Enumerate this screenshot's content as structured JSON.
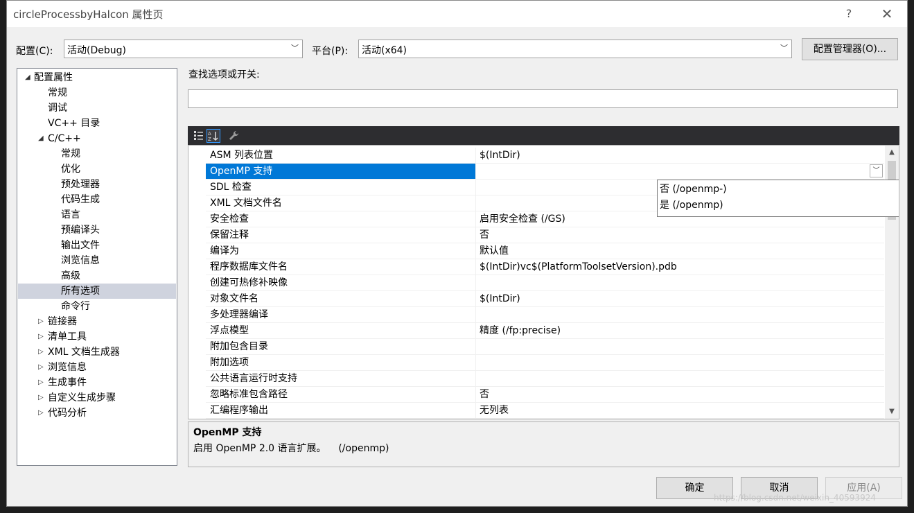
{
  "window": {
    "title": "circleProcessbyHalcon 属性页",
    "help_label": "?",
    "close_label": "✕"
  },
  "config": {
    "config_label": "配置(C):",
    "config_value": "活动(Debug)",
    "platform_label": "平台(P):",
    "platform_value": "活动(x64)",
    "manager_button": "配置管理器(O)..."
  },
  "tree": {
    "items": [
      {
        "label": "配置属性",
        "level": 0,
        "expander": "◢"
      },
      {
        "label": "常规",
        "level": 1,
        "expander": ""
      },
      {
        "label": "调试",
        "level": 1,
        "expander": ""
      },
      {
        "label": "VC++ 目录",
        "level": 1,
        "expander": ""
      },
      {
        "label": "C/C++",
        "level": 1,
        "expander": "◢"
      },
      {
        "label": "常规",
        "level": 2,
        "expander": ""
      },
      {
        "label": "优化",
        "level": 2,
        "expander": ""
      },
      {
        "label": "预处理器",
        "level": 2,
        "expander": ""
      },
      {
        "label": "代码生成",
        "level": 2,
        "expander": ""
      },
      {
        "label": "语言",
        "level": 2,
        "expander": ""
      },
      {
        "label": "预编译头",
        "level": 2,
        "expander": ""
      },
      {
        "label": "输出文件",
        "level": 2,
        "expander": ""
      },
      {
        "label": "浏览信息",
        "level": 2,
        "expander": ""
      },
      {
        "label": "高级",
        "level": 2,
        "expander": ""
      },
      {
        "label": "所有选项",
        "level": 2,
        "expander": "",
        "selected": true
      },
      {
        "label": "命令行",
        "level": 2,
        "expander": ""
      },
      {
        "label": "链接器",
        "level": 1,
        "expander": "▷"
      },
      {
        "label": "清单工具",
        "level": 1,
        "expander": "▷"
      },
      {
        "label": "XML 文档生成器",
        "level": 1,
        "expander": "▷"
      },
      {
        "label": "浏览信息",
        "level": 1,
        "expander": "▷"
      },
      {
        "label": "生成事件",
        "level": 1,
        "expander": "▷"
      },
      {
        "label": "自定义生成步骤",
        "level": 1,
        "expander": "▷"
      },
      {
        "label": "代码分析",
        "level": 1,
        "expander": "▷"
      }
    ]
  },
  "search": {
    "label": "查找选项或开关:",
    "value": ""
  },
  "toolbar": {
    "categorized_icon": "categorized-icon",
    "alphabetical_icon": "alphabetical-icon",
    "property_pages_icon": "wrench-icon"
  },
  "properties": [
    {
      "name": "ASM 列表位置",
      "value": "$(IntDir)"
    },
    {
      "name": "OpenMP 支持",
      "value": "",
      "selected": true
    },
    {
      "name": "SDL 检查",
      "value": ""
    },
    {
      "name": "XML 文档文件名",
      "value": ""
    },
    {
      "name": "安全检查",
      "value": "启用安全检查 (/GS)"
    },
    {
      "name": "保留注释",
      "value": "否"
    },
    {
      "name": "编译为",
      "value": "默认值"
    },
    {
      "name": "程序数据库文件名",
      "value": "$(IntDir)vc$(PlatformToolsetVersion).pdb"
    },
    {
      "name": "创建可热修补映像",
      "value": ""
    },
    {
      "name": "对象文件名",
      "value": "$(IntDir)"
    },
    {
      "name": "多处理器编译",
      "value": ""
    },
    {
      "name": "浮点模型",
      "value": "精度 (/fp:precise)"
    },
    {
      "name": "附加包含目录",
      "value": ""
    },
    {
      "name": "附加选项",
      "value": ""
    },
    {
      "name": "公共语言运行时支持",
      "value": ""
    },
    {
      "name": "忽略标准包含路径",
      "value": "否"
    },
    {
      "name": "汇编程序输出",
      "value": "无列表"
    }
  ],
  "dropdown_options": [
    "否 (/openmp-)",
    "是 (/openmp)"
  ],
  "description": {
    "title": "OpenMP 支持",
    "text": "启用 OpenMP 2.0 语言扩展。    (/openmp)"
  },
  "buttons": {
    "ok": "确定",
    "cancel": "取消",
    "apply": "应用(A)"
  },
  "watermark": "https://blog.csdn.net/weixin_40593924",
  "colors": {
    "selection": "#0078d7",
    "tree_selection": "#cfd3de",
    "toolbar_bg": "#2d2d30"
  }
}
